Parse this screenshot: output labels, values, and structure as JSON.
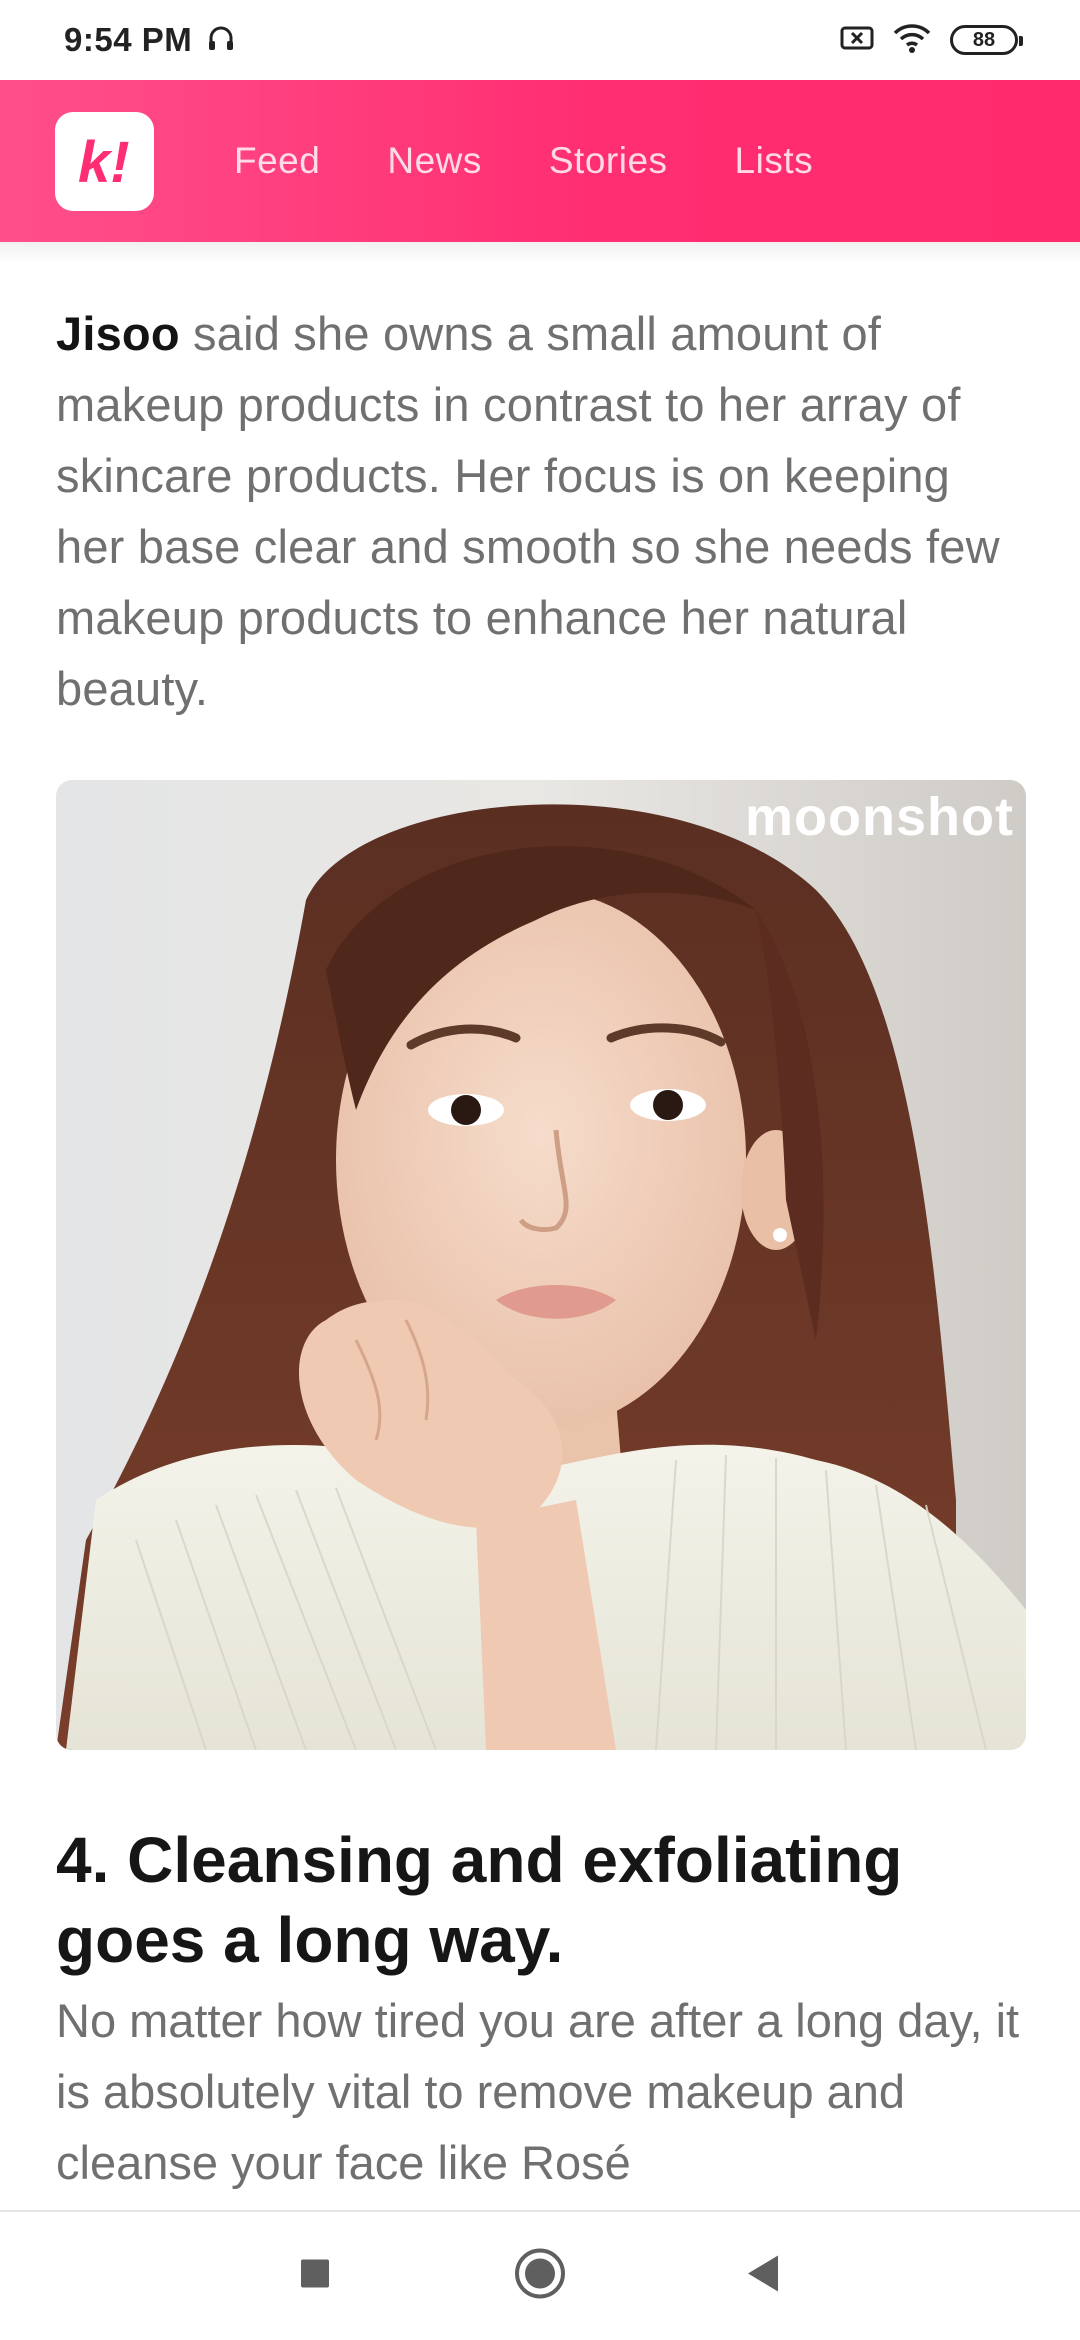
{
  "status_bar": {
    "time": "9:54 PM",
    "battery": "88",
    "icons": [
      "headset-icon",
      "screen-cast-off-icon",
      "wifi-icon",
      "battery-icon"
    ]
  },
  "header": {
    "logo_text": "k!",
    "nav": [
      "Feed",
      "News",
      "Stories",
      "Lists"
    ],
    "accent_color": "#ff2e72"
  },
  "article": {
    "intro_bold": "Jisoo",
    "intro_rest": " said she owns a small amount of makeup products in contrast to her array of skincare products. Her focus is on keeping her base clear and smooth so she needs few makeup products to enhance her natural beauty.",
    "image_watermark": "moonshot",
    "heading": "4. Cleansing and exfoliating goes a long way.",
    "para2": "No matter how tired you are after a long day, it is absolutely vital to remove makeup and cleanse your face like Rosé"
  },
  "system_nav": {
    "icons": [
      "recents-square-icon",
      "home-circle-icon",
      "back-triangle-icon"
    ]
  }
}
